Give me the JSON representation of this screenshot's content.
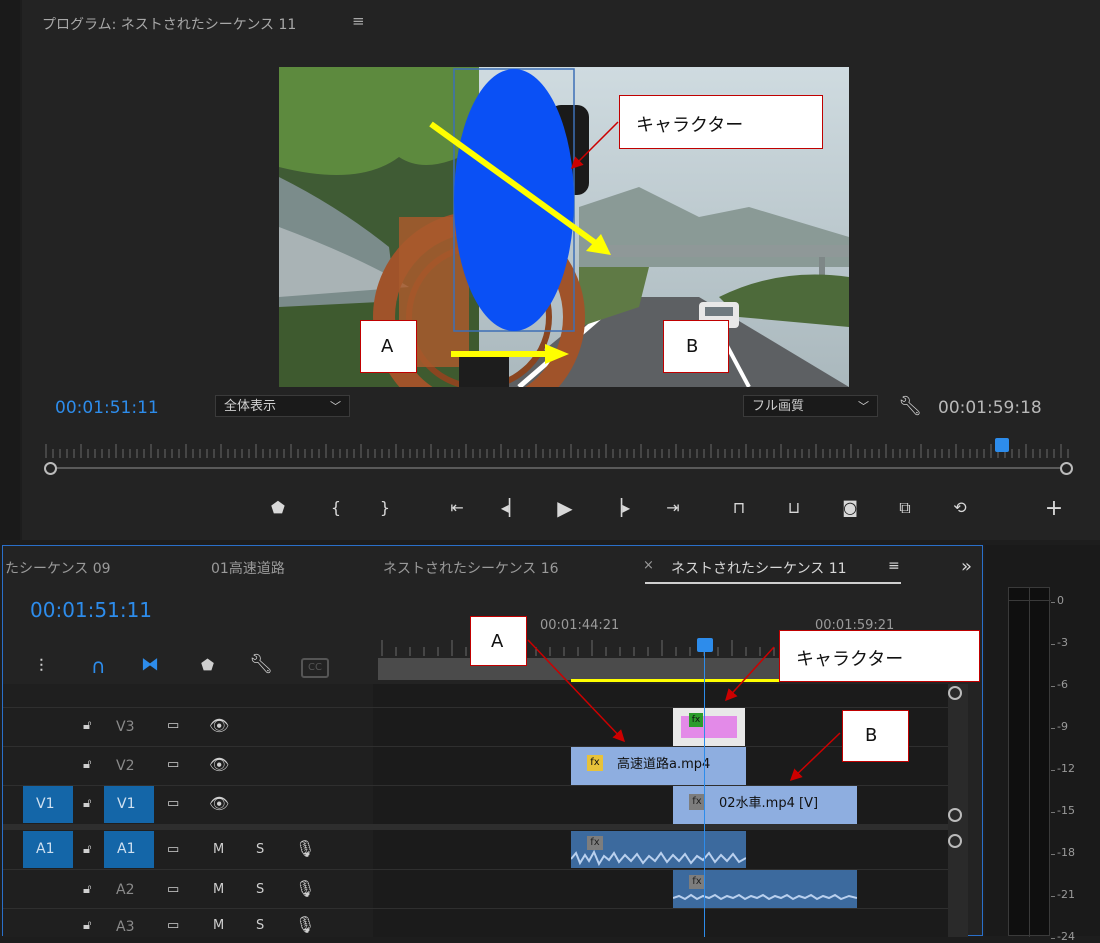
{
  "monitor": {
    "title": "プログラム: ネストされたシーケンス 11",
    "menu_icon": "hamburger-menu-icon",
    "current_time": "00:01:51:11",
    "zoom_select": "全体表示",
    "quality_select": "フル画質",
    "duration": "00:01:59:18",
    "controls": [
      "marker",
      "in-point",
      "out-point",
      "go-to-in",
      "step-back",
      "play",
      "step-forward",
      "go-to-out",
      "lift",
      "extract",
      "export-frame",
      "comparison-view",
      "toggle-proxies",
      "add-button"
    ],
    "controls_glyphs": {
      "marker": "⬟",
      "in": "{",
      "out": "}",
      "goin": "⇤",
      "stepb": "◁|",
      "play": "▶",
      "stepf": "|▷",
      "goout": "⇥",
      "plus": "+"
    },
    "playhead_fraction": 0.92
  },
  "annotations": {
    "character": "キャラクター",
    "a": "A",
    "b": "B",
    "colors": {
      "arrow_red": "#cc0000",
      "arrow_yellow": "#ffff00",
      "character_shape": "#0a50f5"
    }
  },
  "timeline": {
    "tabs": [
      "たシーケンス 09",
      "01高速道路",
      "ネストされたシーケンス 16",
      "ネストされたシーケンス 11"
    ],
    "tab_close": "×",
    "tab_menu": "≡",
    "overflow": "»",
    "current_time": "00:01:51:11",
    "ruler_labels": [
      "00:01:44:21",
      "00:01:59:21"
    ],
    "tools": [
      "insert-tool",
      "snap-tool",
      "linked-select-tool",
      "add-marker-tool",
      "wrench-tool",
      "captions-tool"
    ],
    "cc_label": "CC",
    "tracks": [
      {
        "name": "V3",
        "source": "",
        "type": "video"
      },
      {
        "name": "V2",
        "source": "",
        "type": "video"
      },
      {
        "name": "V1",
        "source": "V1",
        "type": "video"
      },
      {
        "name": "A1",
        "source": "A1",
        "type": "audio"
      },
      {
        "name": "A2",
        "source": "",
        "type": "audio"
      },
      {
        "name": "A3",
        "source": "",
        "type": "audio"
      }
    ],
    "mute_label": "M",
    "solo_label": "S",
    "clips": {
      "v2_clip": "高速道路a.mp4",
      "v1_clip": "02水車.mp4 [V]"
    },
    "fx_label": "fx"
  },
  "meter": {
    "labels": [
      "0",
      "-3",
      "-6",
      "-9",
      "-12",
      "-15",
      "-18",
      "-21",
      "-24"
    ]
  }
}
